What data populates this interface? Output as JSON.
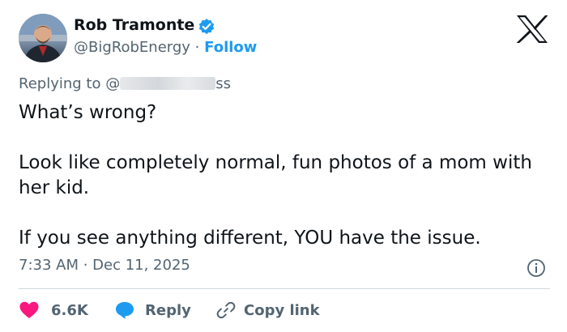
{
  "author": {
    "name": "Rob Tramonte",
    "handle": "@BigRobEnergy",
    "separator": "·",
    "follow_label": "Follow"
  },
  "platform": {
    "logo_icon": "x-logo-icon"
  },
  "reply_context": {
    "prefix": "Replying to @",
    "handle_suffix": "ss"
  },
  "tweet": {
    "paragraphs": [
      "What’s wrong?",
      "Look like completely normal, fun photos of a mom with her kid.",
      "If you see anything different, YOU have the issue."
    ],
    "timestamp": "7:33 AM · Dec 11, 2025"
  },
  "actions": {
    "likes": "6.6K",
    "reply_label": "Reply",
    "copy_link_label": "Copy link"
  },
  "colors": {
    "text": "#0f1419",
    "secondary": "#536471",
    "accent": "#1d9bf0",
    "like": "#f91880",
    "divider": "#cfd9de"
  }
}
